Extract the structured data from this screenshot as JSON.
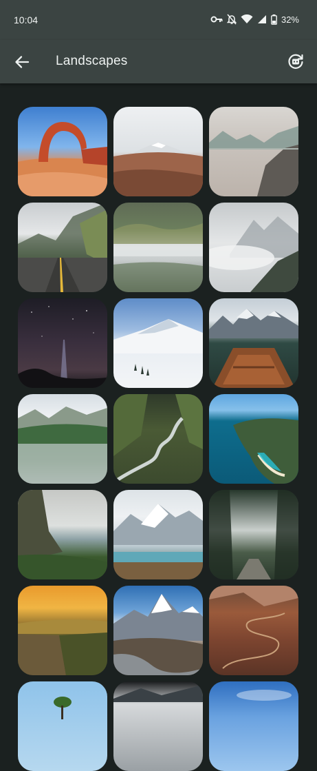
{
  "status": {
    "time": "10:04",
    "battery": "32%",
    "icons": [
      "vpn-key-icon",
      "do-not-disturb-off-icon",
      "wifi-icon",
      "signal-icon",
      "battery-icon"
    ]
  },
  "app_bar": {
    "title": "Landscapes",
    "back_icon": "arrow-back-icon",
    "action_icon": "rotate-wallpaper-icon"
  },
  "wallpapers": [
    {
      "name": "delicate-arch"
    },
    {
      "name": "desert-volcano"
    },
    {
      "name": "misty-lake"
    },
    {
      "name": "mountain-road"
    },
    {
      "name": "foggy-forest-lake"
    },
    {
      "name": "cloudy-peaks"
    },
    {
      "name": "milky-way"
    },
    {
      "name": "snowy-mountain"
    },
    {
      "name": "boat-mountain-lake"
    },
    {
      "name": "alpine-lake"
    },
    {
      "name": "green-valley-stream"
    },
    {
      "name": "coastal-bay"
    },
    {
      "name": "sea-cliffs"
    },
    {
      "name": "glacier-lake"
    },
    {
      "name": "forest-path"
    },
    {
      "name": "sunset-canyon"
    },
    {
      "name": "himalayan-peak"
    },
    {
      "name": "winding-road-canyon"
    },
    {
      "name": "lone-tree"
    },
    {
      "name": "stormy-ridge"
    },
    {
      "name": "blue-sky-horizon"
    }
  ]
}
